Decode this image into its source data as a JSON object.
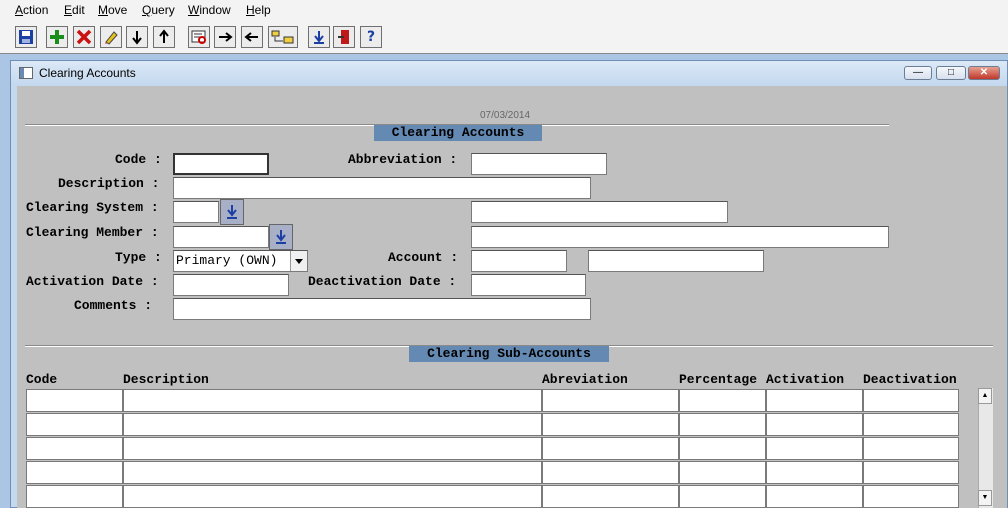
{
  "menu": [
    {
      "label": "Action",
      "key": "A"
    },
    {
      "label": "Edit",
      "key": "E"
    },
    {
      "label": "Move",
      "key": "M"
    },
    {
      "label": "Query",
      "key": "Q"
    },
    {
      "label": "Window",
      "key": "W"
    },
    {
      "label": "Help",
      "key": "H"
    }
  ],
  "toolbar": {
    "icons": [
      "save-icon",
      "add-icon",
      "delete-icon",
      "edit-icon",
      "next-record-icon",
      "previous-record-icon",
      "query-icon",
      "forward-icon",
      "back-icon",
      "sort-icon",
      "download-icon",
      "exit-icon",
      "help-icon"
    ]
  },
  "window": {
    "title": "Clearing Accounts",
    "minimize_glyph": "—",
    "maximize_glyph": "□",
    "close_glyph": "✕"
  },
  "form": {
    "date": "07/03/2014",
    "section_title": "Clearing Accounts",
    "code_label": "Code :",
    "abbreviation_label": "Abbreviation :",
    "description_label": "Description :",
    "clearing_system_label": "Clearing System :",
    "clearing_member_label": "Clearing Member :",
    "type_label": "Type :",
    "type_value": "Primary (OWN)",
    "account_label": "Account :",
    "activation_date_label": "Activation Date :",
    "deactivation_date_label": "Deactivation Date :",
    "comments_label": "Comments :",
    "code_value": "",
    "abbreviation_value": "",
    "description_value": "",
    "clearing_system_value": "",
    "clearing_system_name": "",
    "clearing_member_value": "",
    "clearing_member_name": "",
    "account_value": "",
    "account_name": "",
    "activation_date_value": "",
    "deactivation_date_value": "",
    "comments_value": ""
  },
  "subaccounts": {
    "title": "Clearing Sub-Accounts",
    "columns": [
      "Code",
      "Description",
      "Abreviation",
      "Percentage",
      "Activation",
      "Deactivation"
    ],
    "row_count": 5
  },
  "scrollbar": {
    "up_glyph": "▲",
    "down_glyph": "▼"
  }
}
